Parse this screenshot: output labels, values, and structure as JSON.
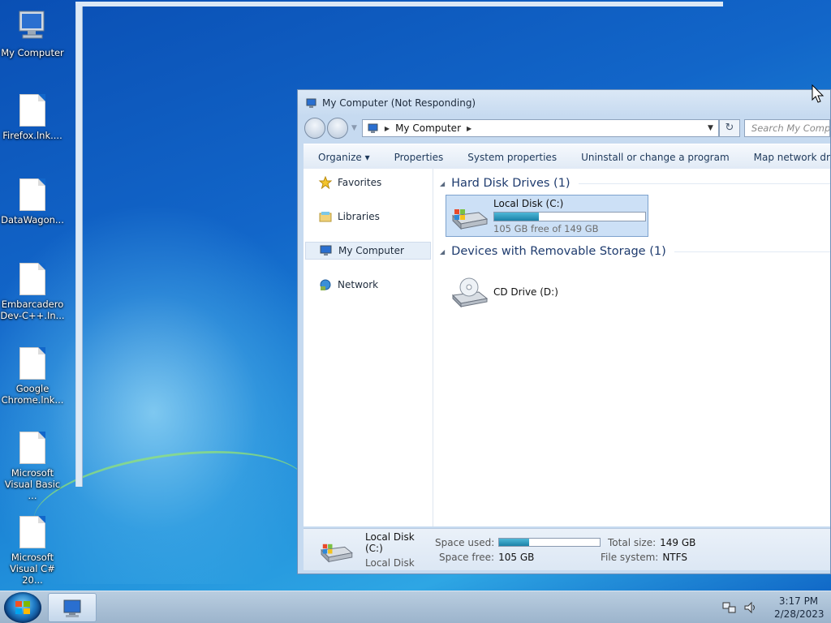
{
  "desktop": {
    "icons": [
      {
        "label": "My Computer"
      },
      {
        "label": "Firefox.lnk...."
      },
      {
        "label": "DataWagon..."
      },
      {
        "label": "Embarcadero Dev-C++.In..."
      },
      {
        "label": "Google Chrome.lnk..."
      },
      {
        "label": "Microsoft Visual Basic ..."
      },
      {
        "label": "Microsoft Visual C# 20..."
      }
    ]
  },
  "window": {
    "title": "My Computer (Not Responding)",
    "address_crumb": "My Computer",
    "search_placeholder": "Search My Computer",
    "toolbar": {
      "organize": "Organize",
      "properties": "Properties",
      "system_properties": "System properties",
      "uninstall": "Uninstall or change a program",
      "map_drive": "Map network drive",
      "more": "»"
    },
    "nav": {
      "favorites": "Favorites",
      "libraries": "Libraries",
      "my_computer": "My Computer",
      "network": "Network"
    },
    "groups": {
      "hard_disks": "Hard Disk Drives (1)",
      "removable": "Devices with Removable Storage (1)"
    },
    "drives": {
      "c": {
        "name": "Local Disk (C:)",
        "free_text": "105 GB free of 149 GB",
        "used_fraction": 0.295
      },
      "d": {
        "name": "CD Drive (D:)"
      }
    },
    "details": {
      "name": "Local Disk (C:)",
      "type": "Local Disk",
      "space_used_label": "Space used:",
      "space_free_label": "Space free:",
      "space_free": "105 GB",
      "total_size_label": "Total size:",
      "total_size": "149 GB",
      "file_system_label": "File system:",
      "file_system": "NTFS"
    }
  },
  "taskbar": {
    "time": "3:17 PM",
    "date": "2/28/2023"
  },
  "colors": {
    "desktop": "#1266c9",
    "selection": "#cce0f6",
    "usage_fill": "#1b82a8"
  }
}
